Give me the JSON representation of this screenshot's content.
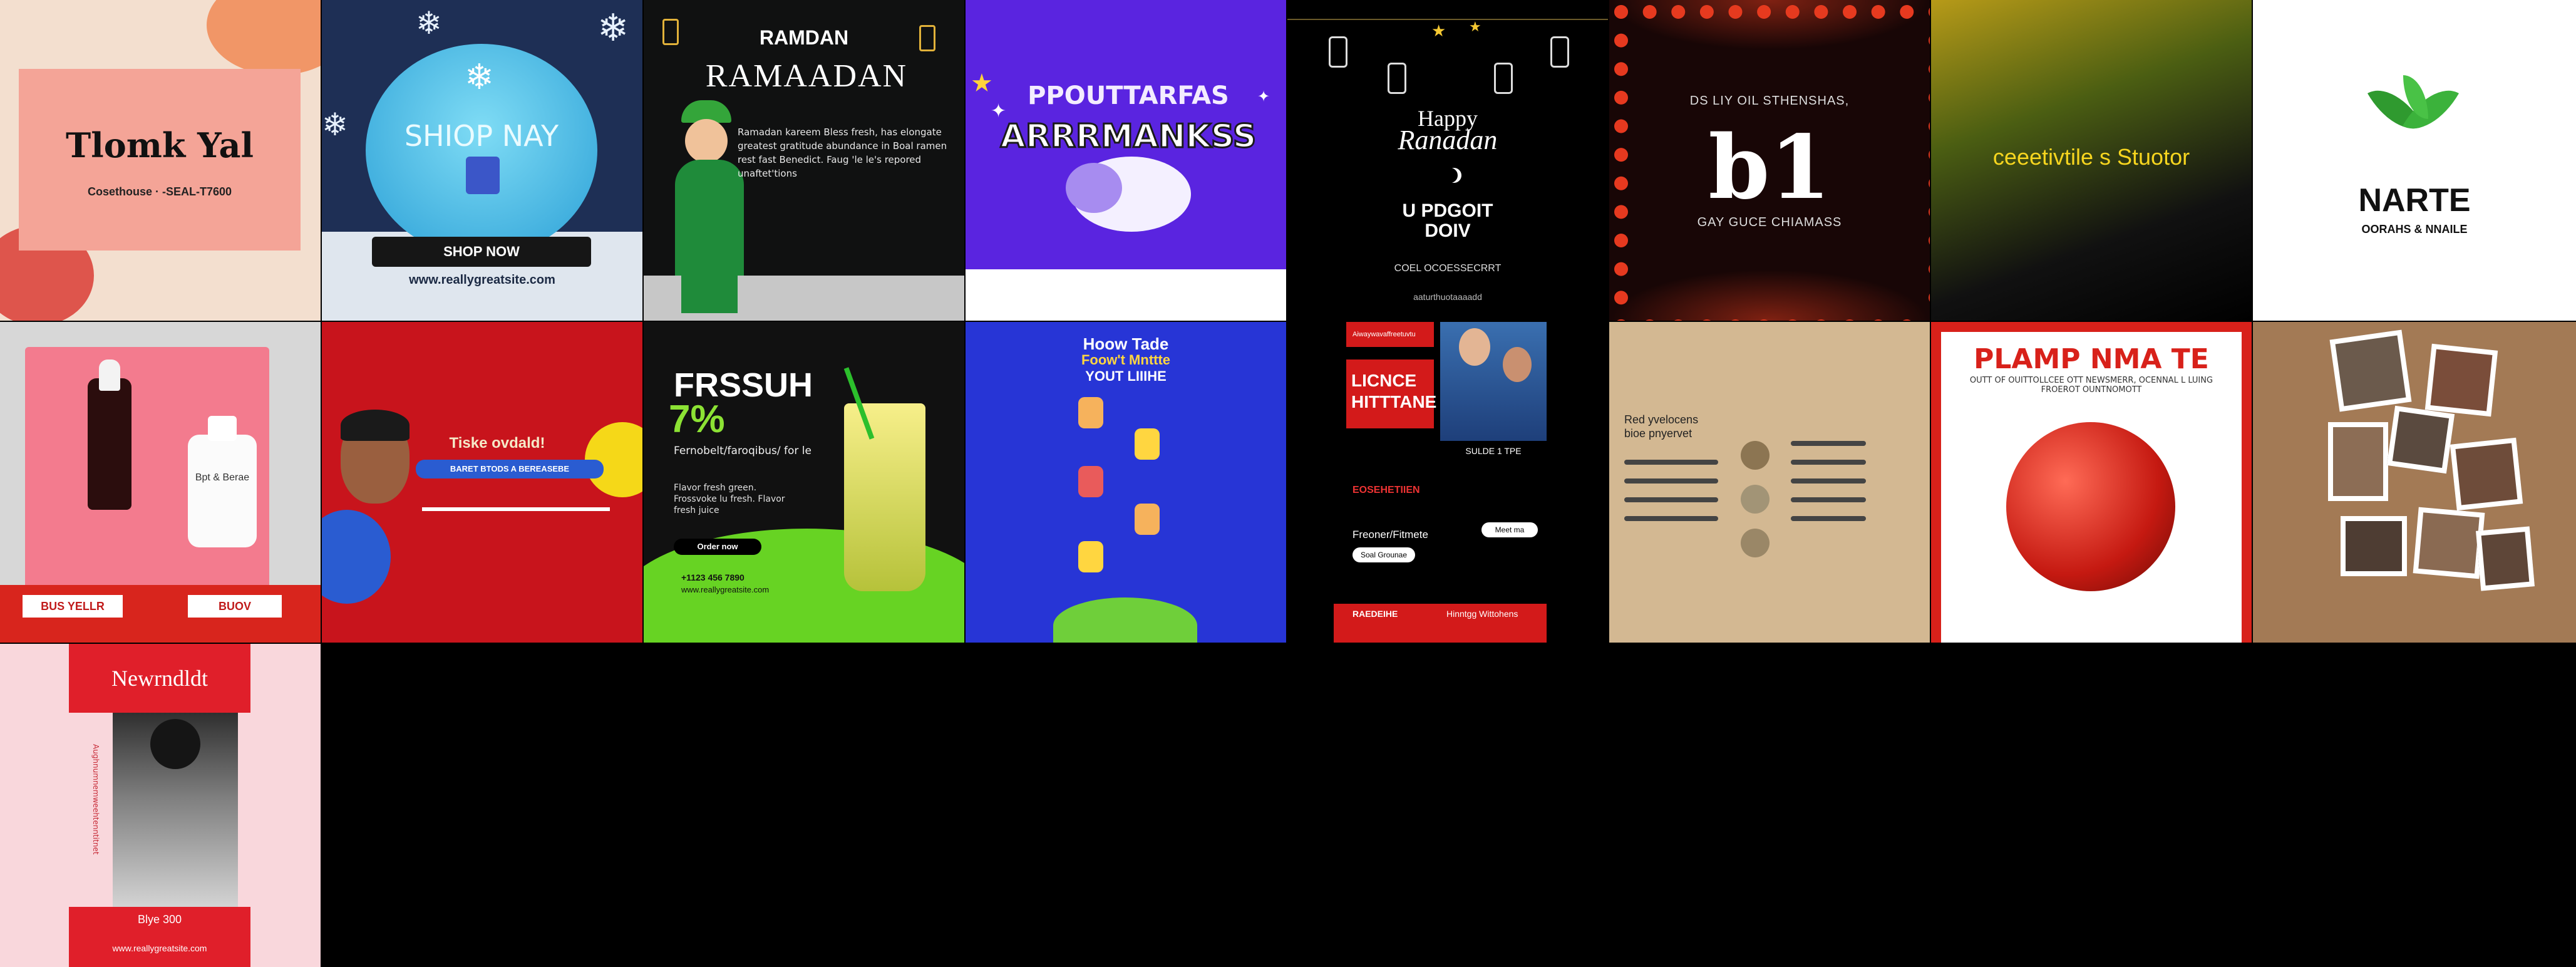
{
  "t01": {
    "title": "Tlomk Yal",
    "subtitle": "Cosethouse · -SEAL-T7600"
  },
  "t02": {
    "title": "SHIOP NAY",
    "button": "SHOP NOW",
    "url": "www.reallygreatsite.com"
  },
  "t03": {
    "top": "RAMDAN",
    "title": "RAMAADAN",
    "body": "Ramadan kareem Bless fresh, has elongate greatest gratitude abundance in Boal ramen rest fast Benedict. Faug 'le le's repored unaftet'tions"
  },
  "t04": {
    "line1": "PPOUTTARFAS",
    "line2": "ARRRMANKSS"
  },
  "t05": {
    "line1": "Happy",
    "line2": "Ranadan",
    "line3": "U PDGOIT",
    "line4": "DOIV",
    "line5": "COEL OCOESSECRRT",
    "line6": "aaturthuotaaaadd"
  },
  "t06": {
    "top": "DS LIY OIL STHENSHAS,",
    "big": "b1",
    "bottom": "GAY GUCE CHIAMASS"
  },
  "t07": {
    "title": "ceeetivtile s Stuotor"
  },
  "t08": {
    "title": "NARTE",
    "subtitle": "OORAHS & NNAILE"
  },
  "t09": {
    "label1": "Bpt & Berae",
    "btn1": "BUS YELLR",
    "btn2": "BUOV"
  },
  "t10": {
    "title": "Tiske ovdald!",
    "pill": "BARET BTODS A BEREASEBE"
  },
  "t11": {
    "title": "FRSSUH",
    "percent": "7%",
    "sub": "Fernobelt/faroqibus/ for le",
    "body": "Flavor fresh green. Frossvoke lu fresh. Flavor fresh juice",
    "btn": "Order now",
    "phone": "+1123 456 7890",
    "url": "www.reallygreatsite.com"
  },
  "t12": {
    "line1": "Hoow Tade",
    "line2": "Foow't Mnttte",
    "line3": "YOUT LIIIHE"
  },
  "t13": {
    "top": "Aiwaywavaffreetuvtu",
    "title1": "LICNCE",
    "title2": "HITTTANE",
    "small": "SULDE 1 TPE",
    "sec": "EOSEHETIIEN",
    "label": "Freoner/Fitmete",
    "pill1": "Soal Grounae",
    "pill2": "Meet ma",
    "foot": "RAEDEIHE",
    "foot2": "Hinntgg Wittohens"
  },
  "t14": {
    "h1": "Red yvelocens",
    "h2": "bioe pnyervet"
  },
  "t15": {
    "title": "PLAMP NMA TE",
    "sub": "OUTT OF OUITTOLLCEE OTT NEWSMERR, OCENNAL L LUING FROEROT OUNTNOMOTT"
  },
  "t16": {},
  "t17": {
    "title": "Newrndldt",
    "side": "Aughnumnemweehtenntitnet",
    "foot1": "Blye 300",
    "foot2": "www.reallygreatsite.com"
  }
}
